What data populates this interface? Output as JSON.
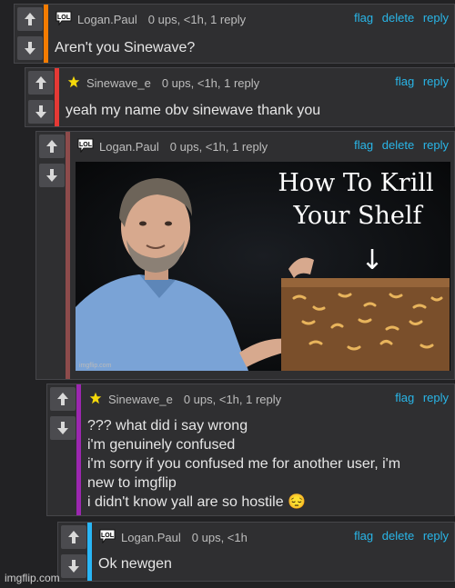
{
  "comments": [
    {
      "author": "Logan.Paul",
      "badge": "LOL",
      "meta": "0 ups, <1h, 1 reply",
      "actions": [
        "flag",
        "delete",
        "reply"
      ],
      "text": "Aren't you Sinewave?",
      "bar_color": "#f57c00"
    },
    {
      "author": "Sinewave_e",
      "badge": "star-icon",
      "meta": "0 ups, <1h, 1 reply",
      "actions": [
        "flag",
        "reply"
      ],
      "text": "yeah my name obv sinewave thank you",
      "bar_color": "#e53935"
    },
    {
      "author": "Logan.Paul",
      "badge": "LOL",
      "meta": "0 ups, <1h, 1 reply",
      "actions": [
        "flag",
        "delete",
        "reply"
      ],
      "image": {
        "caption_line1": "How To Krill",
        "caption_line2": "Your Shelf",
        "arrow": "↓",
        "watermark": "imgflip.com"
      },
      "bar_color": "#8d4b4b"
    },
    {
      "author": "Sinewave_e",
      "badge": "star-icon",
      "meta": "0 ups, <1h, 1 reply",
      "actions": [
        "flag",
        "reply"
      ],
      "lines": [
        "??? what did i say wrong",
        "i'm genuinely confused",
        "i'm sorry if you confused me for another user, i'm",
        "new to imgflip",
        "i didn't know yall are so hostile 😔"
      ],
      "bar_color": "#9c27b0"
    },
    {
      "author": "Logan.Paul",
      "badge": "LOL",
      "meta": "0 ups, <1h",
      "actions": [
        "flag",
        "delete",
        "reply"
      ],
      "text": "Ok newgen",
      "bar_color": "#29b6f6"
    }
  ],
  "watermark": "imgflip.com",
  "colors": {
    "link": "#29b6e8",
    "panel": "#2f2f31",
    "background": "#222224"
  }
}
